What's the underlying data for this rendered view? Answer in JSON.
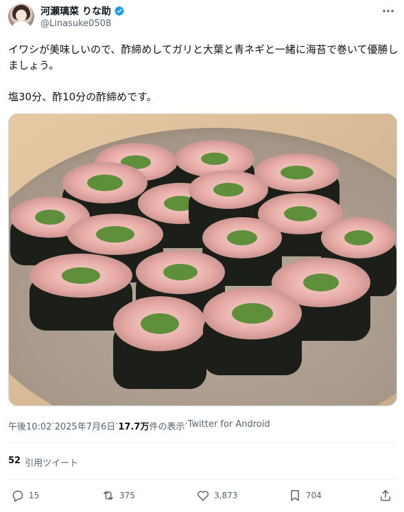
{
  "author": {
    "display_name": "河瀬璃菜 りな助",
    "handle": "@Linasuke0508",
    "verified": true
  },
  "tweet": {
    "text": "イワシが美味しいので、酢締めしてガリと大葉と青ネギと一緒に海苔で巻いて優勝しましょう。\n\n塩30分、酢10分の酢締めです。",
    "media_description_icon": "photo-sushi-rolls"
  },
  "meta": {
    "time": "午後10:02",
    "sep1": " · ",
    "date": "2025年7月6日",
    "sep2": " · ",
    "views": "17.7万",
    "views_label": " 件の表示",
    "sep3": " · ",
    "source": "Twitter for Android"
  },
  "quotes": {
    "count": "52",
    "label": "引用ツイート"
  },
  "actions": {
    "replies": "15",
    "retweets": "375",
    "likes": "3,873",
    "bookmarks": "704"
  },
  "colors": {
    "verified_blue": "#1d9bf0",
    "secondary_text": "#536471",
    "divider": "#eff3f4"
  }
}
